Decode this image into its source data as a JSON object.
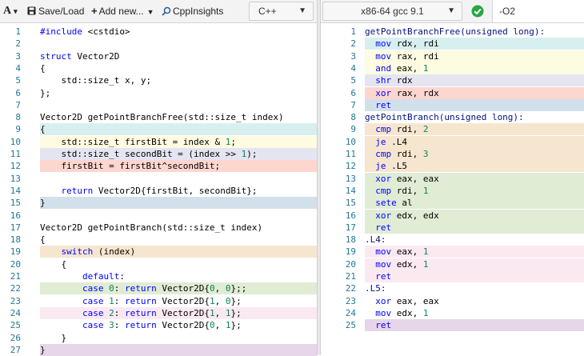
{
  "source_toolbar": {
    "font_button": "A",
    "save_load": "Save/Load",
    "add_new": "Add new...",
    "cppinsights": "CppInsights",
    "language": "C++"
  },
  "asm_toolbar": {
    "compiler": "x86-64 gcc 9.1",
    "options": "-O2"
  },
  "highlight_colors": {
    "teal": "#d8efef",
    "yellow": "#fdfbe1",
    "lavender": "#e4e5f0",
    "red": "#fdd6d0",
    "blue": "#d2e0eb",
    "orange": "#f6e6cf",
    "green": "#e0ecd4",
    "pink": "#fbe9f2",
    "purple": "#e7d5e9"
  },
  "source_lines": [
    {
      "n": "1",
      "text": "#include <cstdio>",
      "hl": ""
    },
    {
      "n": "2",
      "text": "",
      "hl": ""
    },
    {
      "n": "3",
      "text": "struct Vector2D",
      "hl": ""
    },
    {
      "n": "4",
      "text": "{",
      "hl": ""
    },
    {
      "n": "5",
      "text": "    std::size_t x, y;",
      "hl": ""
    },
    {
      "n": "6",
      "text": "};",
      "hl": ""
    },
    {
      "n": "7",
      "text": "",
      "hl": ""
    },
    {
      "n": "8",
      "text": "Vector2D getPointBranchFree(std::size_t index)",
      "hl": ""
    },
    {
      "n": "9",
      "text": "{",
      "hl": "teal"
    },
    {
      "n": "10",
      "text": "    std::size_t firstBit = index & 1;",
      "hl": "yellow"
    },
    {
      "n": "11",
      "text": "    std::size_t secondBit = (index >> 1);",
      "hl": "lavender"
    },
    {
      "n": "12",
      "text": "    firstBit = firstBit^secondBit;",
      "hl": "red"
    },
    {
      "n": "13",
      "text": "",
      "hl": ""
    },
    {
      "n": "14",
      "text": "    return Vector2D{firstBit, secondBit};",
      "hl": ""
    },
    {
      "n": "15",
      "text": "}",
      "hl": "blue"
    },
    {
      "n": "16",
      "text": "",
      "hl": ""
    },
    {
      "n": "17",
      "text": "Vector2D getPointBranch(std::size_t index)",
      "hl": ""
    },
    {
      "n": "18",
      "text": "{",
      "hl": ""
    },
    {
      "n": "19",
      "text": "    switch (index)",
      "hl": "orange"
    },
    {
      "n": "20",
      "text": "    {",
      "hl": ""
    },
    {
      "n": "21",
      "text": "        default:",
      "hl": ""
    },
    {
      "n": "22",
      "text": "        case 0: return Vector2D{0, 0};;",
      "hl": "green"
    },
    {
      "n": "23",
      "text": "        case 1: return Vector2D{1, 0};",
      "hl": ""
    },
    {
      "n": "24",
      "text": "        case 2: return Vector2D{1, 1};",
      "hl": "pink"
    },
    {
      "n": "25",
      "text": "        case 3: return Vector2D{0, 1};",
      "hl": ""
    },
    {
      "n": "26",
      "text": "    }",
      "hl": ""
    },
    {
      "n": "27",
      "text": "}",
      "hl": "purple"
    }
  ],
  "asm_lines": [
    {
      "n": "1",
      "text": "getPointBranchFree(unsigned long):",
      "hl": ""
    },
    {
      "n": "2",
      "text": "  mov rdx, rdi",
      "hl": "teal"
    },
    {
      "n": "3",
      "text": "  mov rax, rdi",
      "hl": "yellow"
    },
    {
      "n": "4",
      "text": "  and eax, 1",
      "hl": "yellow"
    },
    {
      "n": "5",
      "text": "  shr rdx",
      "hl": "lavender"
    },
    {
      "n": "6",
      "text": "  xor rax, rdx",
      "hl": "red"
    },
    {
      "n": "7",
      "text": "  ret",
      "hl": "blue"
    },
    {
      "n": "8",
      "text": "getPointBranch(unsigned long):",
      "hl": ""
    },
    {
      "n": "9",
      "text": "  cmp rdi, 2",
      "hl": "orange"
    },
    {
      "n": "10",
      "text": "  je .L4",
      "hl": "orange"
    },
    {
      "n": "11",
      "text": "  cmp rdi, 3",
      "hl": "orange"
    },
    {
      "n": "12",
      "text": "  je .L5",
      "hl": "orange"
    },
    {
      "n": "13",
      "text": "  xor eax, eax",
      "hl": "green"
    },
    {
      "n": "14",
      "text": "  cmp rdi, 1",
      "hl": "green"
    },
    {
      "n": "15",
      "text": "  sete al",
      "hl": "green"
    },
    {
      "n": "16",
      "text": "  xor edx, edx",
      "hl": "green"
    },
    {
      "n": "17",
      "text": "  ret",
      "hl": "green"
    },
    {
      "n": "18",
      "text": ".L4:",
      "hl": ""
    },
    {
      "n": "19",
      "text": "  mov eax, 1",
      "hl": "pink"
    },
    {
      "n": "20",
      "text": "  mov edx, 1",
      "hl": "pink"
    },
    {
      "n": "21",
      "text": "  ret",
      "hl": "pink"
    },
    {
      "n": "22",
      "text": ".L5:",
      "hl": ""
    },
    {
      "n": "23",
      "text": "  xor eax, eax",
      "hl": ""
    },
    {
      "n": "24",
      "text": "  mov edx, 1",
      "hl": ""
    },
    {
      "n": "25",
      "text": "  ret",
      "hl": "purple"
    }
  ]
}
